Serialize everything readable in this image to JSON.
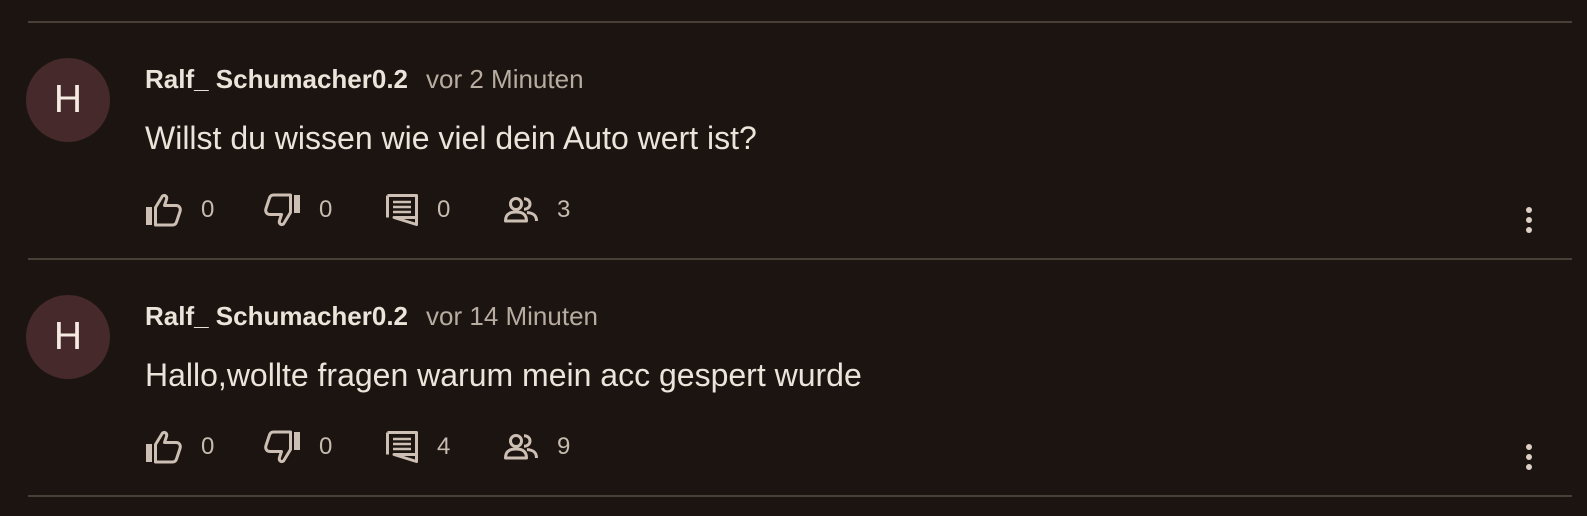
{
  "comments": [
    {
      "avatar_letter": "H",
      "username": "Ralf_ Schumacher0.2",
      "time": "vor 2 Minuten",
      "text": "Willst du wissen wie viel dein Auto wert ist?",
      "likes": "0",
      "dislikes": "0",
      "replies": "0",
      "participants": "3"
    },
    {
      "avatar_letter": "H",
      "username": "Ralf_ Schumacher0.2",
      "time": "vor 14 Minuten",
      "text": "Hallo,wollte fragen warum mein acc gespert wurde",
      "likes": "0",
      "dislikes": "0",
      "replies": "4",
      "participants": "9"
    }
  ],
  "icons": {
    "like": "thumb-up-icon",
    "dislike": "thumb-down-icon",
    "reply": "comment-icon",
    "participants": "people-icon",
    "more": "more-vertical-icon"
  },
  "colors": {
    "background": "#1b1410",
    "avatar": "#46292a",
    "divider": "#4a3f36",
    "text": "#ece3da",
    "muted": "#b8aca1"
  }
}
